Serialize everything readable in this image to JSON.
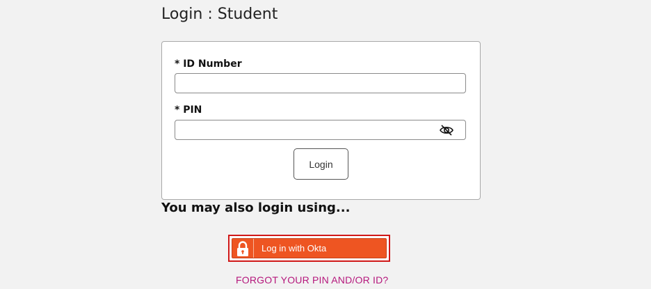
{
  "page": {
    "title": "Login : Student"
  },
  "form": {
    "id_label": "* ID Number",
    "id_value": "",
    "pin_label": "* PIN",
    "pin_value": "",
    "login_label": "Login"
  },
  "alternate": {
    "heading": "You may also login using...",
    "okta_label": "Log in with Okta",
    "okta_icon": "lock-icon"
  },
  "links": {
    "forgot": "FORGOT YOUR PIN AND/OR ID?"
  },
  "colors": {
    "okta_orange": "#ee5522",
    "highlight_red": "#d01818",
    "link_magenta": "#b5177c",
    "background": "#f2f2f2"
  }
}
